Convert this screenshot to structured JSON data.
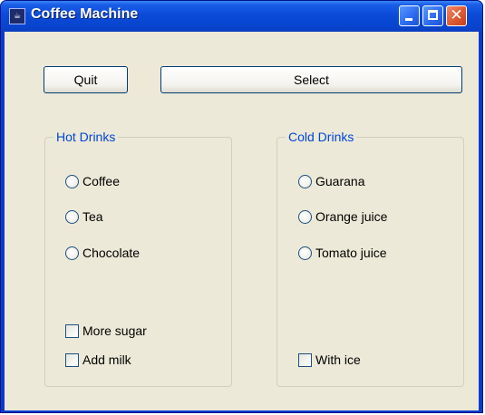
{
  "window": {
    "title": "Coffee Machine",
    "icon": "app-icon",
    "controls": {
      "minimize": "minimize-icon",
      "maximize": "maximize-icon",
      "close": "close-icon"
    }
  },
  "toolbar": {
    "quit_label": "Quit",
    "select_label": "Select"
  },
  "hot_drinks": {
    "label": "Hot Drinks",
    "options": [
      {
        "label": "Coffee",
        "selected": false
      },
      {
        "label": "Tea",
        "selected": false
      },
      {
        "label": "Chocolate",
        "selected": false
      }
    ],
    "extras": [
      {
        "label": "More sugar",
        "checked": false
      },
      {
        "label": "Add milk",
        "checked": false
      }
    ]
  },
  "cold_drinks": {
    "label": "Cold Drinks",
    "options": [
      {
        "label": "Guarana",
        "selected": false
      },
      {
        "label": "Orange juice",
        "selected": false
      },
      {
        "label": "Tomato juice",
        "selected": false
      }
    ],
    "extras": [
      {
        "label": "With ice",
        "checked": false
      }
    ]
  },
  "colors": {
    "titlebar": "#0a3cc8",
    "client_bg": "#ece9d8",
    "group_label": "#0046d5",
    "close_button": "#e05a32"
  }
}
